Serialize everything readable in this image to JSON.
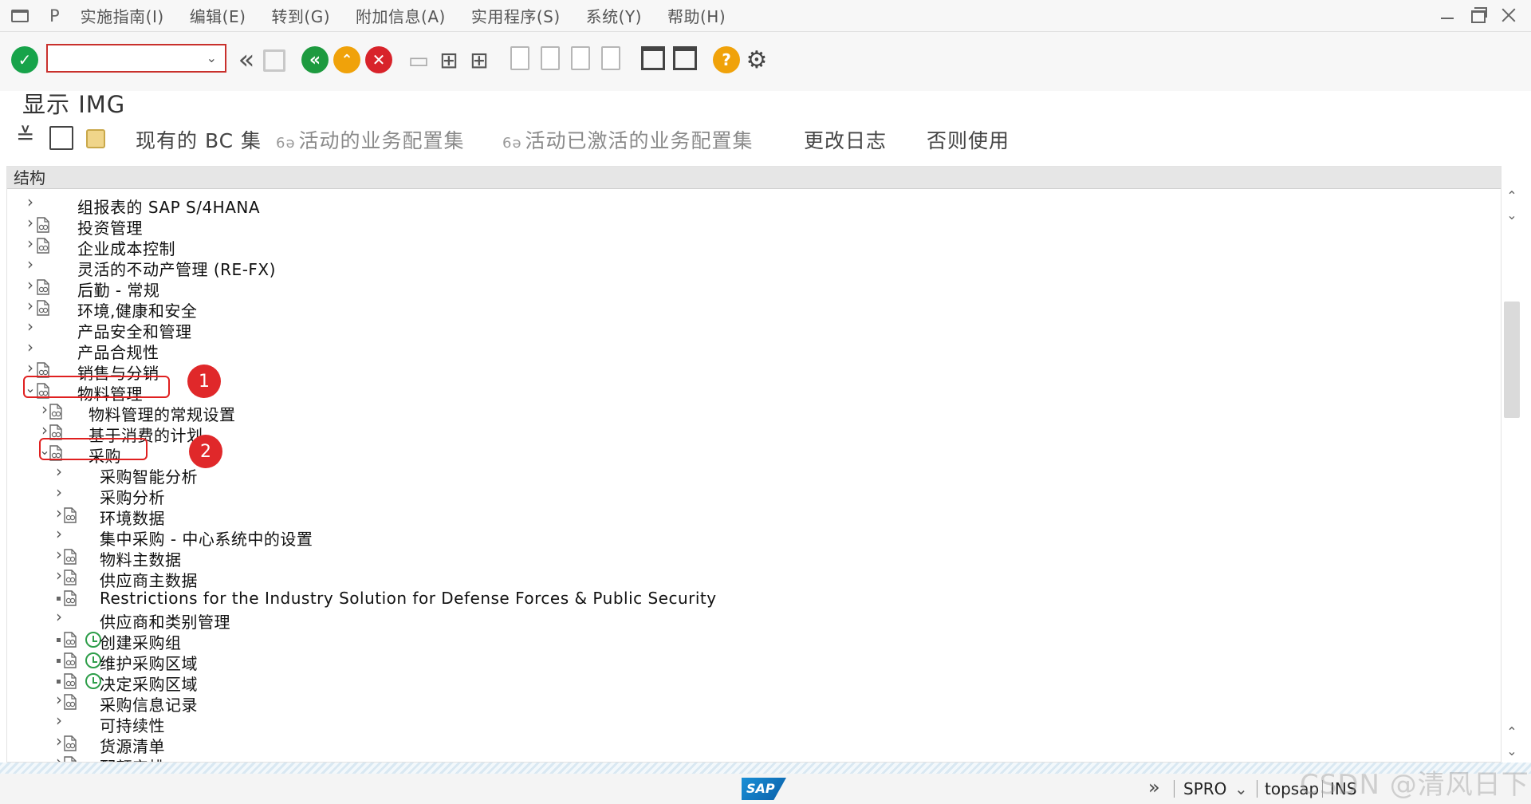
{
  "menu": {
    "items": [
      "实施指南(I)",
      "编辑(E)",
      "转到(G)",
      "附加信息(A)",
      "实用程序(S)",
      "系统(Y)",
      "帮助(H)"
    ],
    "p_icon": "P"
  },
  "toolbar": {
    "command_value": "",
    "icons": [
      "check-icon",
      "back-double-icon",
      "save-icon",
      "back-icon",
      "exit-icon",
      "cancel-icon",
      "print-icon",
      "find-icon",
      "find-next-icon",
      "first-page-icon",
      "prev-page-icon",
      "next-page-icon",
      "last-page-icon",
      "new-session-icon",
      "shortcut-icon",
      "help-icon",
      "settings-icon"
    ]
  },
  "title": "显示 IMG",
  "app_toolbar": {
    "bc_set": "现有的 BC 集",
    "active_bc": "活动的业务配置集",
    "activated_bc": "活动已激活的业务配置集",
    "change_log": "更改日志",
    "where_used": "否则使用"
  },
  "tree": {
    "header": "结构",
    "rows": [
      {
        "text": "组报表的 SAP S/4HANA",
        "level": 0,
        "expander": ">",
        "doc": false,
        "clock": false
      },
      {
        "text": "投资管理",
        "level": 0,
        "expander": ">",
        "doc": true,
        "clock": false
      },
      {
        "text": "企业成本控制",
        "level": 0,
        "expander": ">",
        "doc": true,
        "clock": false
      },
      {
        "text": "灵活的不动产管理 (RE-FX)",
        "level": 0,
        "expander": ">",
        "doc": false,
        "clock": false
      },
      {
        "text": "后勤 - 常规",
        "level": 0,
        "expander": ">",
        "doc": true,
        "clock": false
      },
      {
        "text": "环境,健康和安全",
        "level": 0,
        "expander": ">",
        "doc": true,
        "clock": false
      },
      {
        "text": "产品安全和管理",
        "level": 0,
        "expander": ">",
        "doc": false,
        "clock": false
      },
      {
        "text": "产品合规性",
        "level": 0,
        "expander": ">",
        "doc": false,
        "clock": false
      },
      {
        "text": "销售与分销",
        "level": 0,
        "expander": ">",
        "doc": true,
        "clock": false
      },
      {
        "text": "物料管理",
        "level": 0,
        "expander": "v",
        "doc": true,
        "clock": false
      },
      {
        "text": "物料管理的常规设置",
        "level": 1,
        "expander": ">",
        "doc": true,
        "clock": false
      },
      {
        "text": "基于消费的计划",
        "level": 1,
        "expander": ">",
        "doc": true,
        "clock": false
      },
      {
        "text": "采购",
        "level": 1,
        "expander": "v",
        "doc": true,
        "clock": false
      },
      {
        "text": "采购智能分析",
        "level": 2,
        "expander": ">",
        "doc": false,
        "clock": false
      },
      {
        "text": "采购分析",
        "level": 2,
        "expander": ">",
        "doc": false,
        "clock": false
      },
      {
        "text": "环境数据",
        "level": 2,
        "expander": ">",
        "doc": true,
        "clock": false
      },
      {
        "text": "集中采购 - 中心系统中的设置",
        "level": 2,
        "expander": ">",
        "doc": false,
        "clock": false
      },
      {
        "text": "物料主数据",
        "level": 2,
        "expander": ">",
        "doc": true,
        "clock": false
      },
      {
        "text": "供应商主数据",
        "level": 2,
        "expander": ">",
        "doc": true,
        "clock": false
      },
      {
        "text": "Restrictions for the Industry Solution for Defense Forces & Public Security",
        "level": 2,
        "expander": "dot",
        "doc": true,
        "clock": false
      },
      {
        "text": "供应商和类别管理",
        "level": 2,
        "expander": ">",
        "doc": false,
        "clock": false
      },
      {
        "text": "创建采购组",
        "level": 2,
        "expander": "dot",
        "doc": true,
        "clock": true
      },
      {
        "text": "维护采购区域",
        "level": 2,
        "expander": "dot",
        "doc": true,
        "clock": true
      },
      {
        "text": "决定采购区域",
        "level": 2,
        "expander": "dot",
        "doc": true,
        "clock": true
      },
      {
        "text": "采购信息记录",
        "level": 2,
        "expander": ">",
        "doc": true,
        "clock": false
      },
      {
        "text": "可持续性",
        "level": 2,
        "expander": ">",
        "doc": false,
        "clock": false
      },
      {
        "text": "货源清单",
        "level": 2,
        "expander": ">",
        "doc": true,
        "clock": false
      },
      {
        "text": "配额安排",
        "level": 2,
        "expander": ">",
        "doc": true,
        "clock": false
      }
    ]
  },
  "annotations": {
    "badge1": "1",
    "badge2": "2"
  },
  "status": {
    "logo": "SAP",
    "transaction": "SPRO",
    "system": "topsap",
    "mode": "INS",
    "watermark": "CSDN @清风日下"
  },
  "colors": {
    "accent_red": "#e0282a",
    "ok_green": "#17a34a",
    "warn_orange": "#f0a20a",
    "cancel_red": "#d8232a",
    "back_green": "#1d9a3f"
  }
}
